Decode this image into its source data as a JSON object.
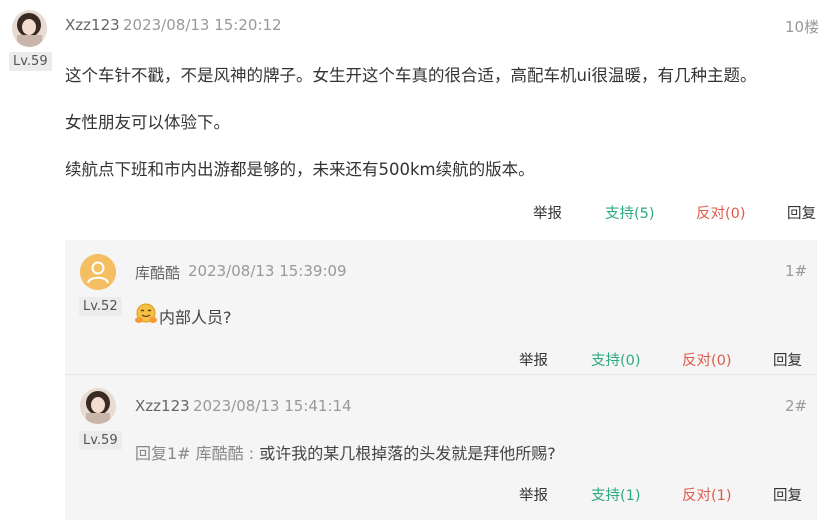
{
  "post": {
    "username": "Xzz123",
    "timestamp": "2023/08/13 15:20:12",
    "floor": "10楼",
    "level": "Lv.59",
    "paragraphs": [
      "这个车针不戳，不是风神的牌子。女生开这个车真的很合适，高配车机ui很温暖，有几种主题。",
      "女性朋友可以体验下。",
      "续航点下班和市内出游都是够的，未来还有500km续航的版本。"
    ],
    "actions": {
      "report": "举报",
      "support": "支持(5)",
      "oppose": "反对(0)",
      "reply": "回复"
    }
  },
  "replies": [
    {
      "username": "库酷酷",
      "timestamp": "2023/08/13 15:39:09",
      "floor": "1#",
      "level": "Lv.52",
      "emoji_icon": "hugging-face-emoji",
      "text": "内部人员?",
      "actions": {
        "report": "举报",
        "support": "支持(0)",
        "oppose": "反对(0)",
        "reply": "回复"
      }
    },
    {
      "username": "Xzz123",
      "timestamp": "2023/08/13 15:41:14",
      "floor": "2#",
      "level": "Lv.59",
      "quote": "回复1# 库酷酷 :",
      "text": "或许我的某几根掉落的头发就是拜他所赐?",
      "actions": {
        "report": "举报",
        "support": "支持(1)",
        "oppose": "反对(1)",
        "reply": "回复"
      }
    }
  ],
  "colors": {
    "support": "#2eab7e",
    "oppose": "#e05a4a",
    "reply_bg": "#f5f5f5",
    "default_avatar": "#f3bf62"
  }
}
